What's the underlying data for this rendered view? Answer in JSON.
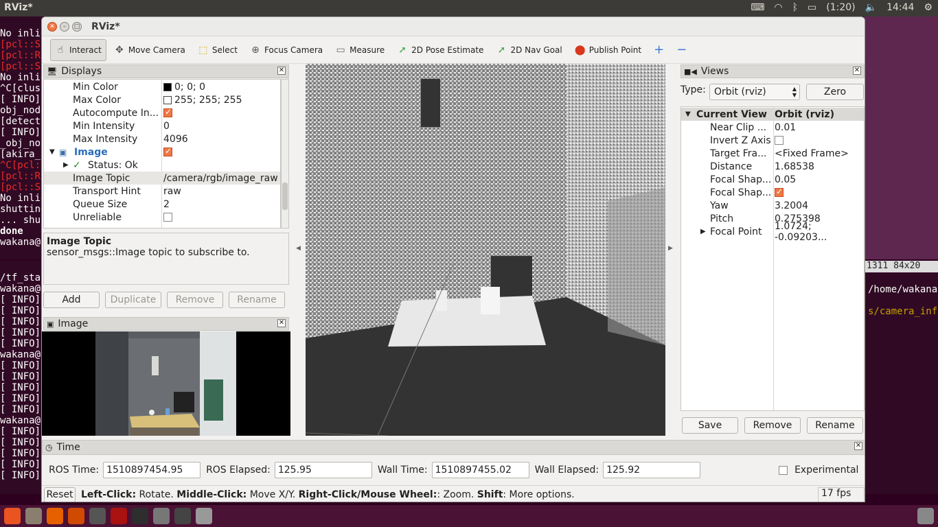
{
  "os": {
    "topbar_title": "RViz*",
    "battery": "(1:20)",
    "clock": "14:44"
  },
  "terminal1_lines": [
    {
      "t": "No inlie",
      "c": ""
    },
    {
      "t": "[pcl::S",
      "c": "red"
    },
    {
      "t": "[pcl::R",
      "c": "red"
    },
    {
      "t": "[pcl::S",
      "c": "red"
    },
    {
      "t": "No inlie",
      "c": ""
    },
    {
      "t": "^C[clust",
      "c": ""
    },
    {
      "t": "[ INFO]",
      "c": ""
    },
    {
      "t": "obj_node",
      "c": ""
    },
    {
      "t": "[detecto",
      "c": ""
    },
    {
      "t": "[ INFO]",
      "c": ""
    },
    {
      "t": "_obj_no",
      "c": ""
    },
    {
      "t": "[akira_",
      "c": ""
    },
    {
      "t": "^C[pcl:",
      "c": "red"
    },
    {
      "t": "[pcl::R",
      "c": "red"
    },
    {
      "t": "[pcl::S",
      "c": "red"
    },
    {
      "t": "No inlie",
      "c": ""
    },
    {
      "t": "shutting",
      "c": ""
    },
    {
      "t": "... shu",
      "c": ""
    },
    {
      "t": "done",
      "c": "bold"
    },
    {
      "t": "wakana@",
      "c": ""
    }
  ],
  "terminal2_lines": [
    "/tf_sta",
    "wakana@",
    "[ INFO]",
    "[ INFO]",
    "[ INFO]",
    "[ INFO]",
    "[ INFO]",
    "wakana@",
    "[ INFO]",
    "[ INFO]",
    "[ INFO]",
    "[ INFO]",
    "[ INFO]",
    "wakana@",
    "[ INFO]",
    "[ INFO]",
    "[ INFO]",
    "[ INFO]",
    "[ INFO]"
  ],
  "terminal3": {
    "size": "1311 84x20",
    "path": "/home/wakana",
    "topic": "s/camera_inf"
  },
  "window": {
    "title": "RViz*"
  },
  "toolbar": [
    {
      "label": "Interact",
      "icon": "hand-icon",
      "color": "#444",
      "active": true
    },
    {
      "label": "Move Camera",
      "icon": "move-camera-icon",
      "color": "#555",
      "active": false
    },
    {
      "label": "Select",
      "icon": "select-icon",
      "color": "#c9a400",
      "active": false
    },
    {
      "label": "Focus Camera",
      "icon": "focus-camera-icon",
      "color": "#555",
      "active": false
    },
    {
      "label": "Measure",
      "icon": "ruler-icon",
      "color": "#666",
      "active": false
    },
    {
      "label": "2D Pose Estimate",
      "icon": "pose-arrow-icon",
      "color": "#3fa53f",
      "active": false
    },
    {
      "label": "2D Nav Goal",
      "icon": "nav-goal-arrow-icon",
      "color": "#3fa53f",
      "active": false
    },
    {
      "label": "Publish Point",
      "icon": "map-pin-icon",
      "color": "#d9381e",
      "active": false
    }
  ],
  "toolbar_extra": {
    "plus": "+",
    "minus": "−"
  },
  "displays": {
    "title": "Displays",
    "rows": [
      {
        "key": "Min Color",
        "val": "0; 0; 0",
        "type": "color",
        "swatch": "#000000",
        "indent": 42
      },
      {
        "key": "Max Color",
        "val": "255; 255; 255",
        "type": "color",
        "swatch": "#ffffff",
        "indent": 42
      },
      {
        "key": "Autocompute In...",
        "val": "",
        "type": "check",
        "on": true,
        "indent": 42
      },
      {
        "key": "Min Intensity",
        "val": "0",
        "type": "text",
        "indent": 42
      },
      {
        "key": "Max Intensity",
        "val": "4096",
        "type": "text",
        "indent": 42
      },
      {
        "key": "Image",
        "val": "",
        "type": "check",
        "on": true,
        "indent": 44,
        "isImage": true
      },
      {
        "key": "Status: Ok",
        "val": "",
        "type": "status",
        "indent": 64
      },
      {
        "key": "Image Topic",
        "val": "/camera/rgb/image_raw",
        "type": "text",
        "indent": 42,
        "sel": true
      },
      {
        "key": "Transport Hint",
        "val": "raw",
        "type": "text",
        "indent": 42
      },
      {
        "key": "Queue Size",
        "val": "2",
        "type": "text",
        "indent": 42
      },
      {
        "key": "Unreliable",
        "val": "",
        "type": "check",
        "on": false,
        "indent": 42
      }
    ],
    "desc_title": "Image Topic",
    "desc_text": "sensor_msgs::Image topic to subscribe to.",
    "buttons": [
      "Add",
      "Duplicate",
      "Remove",
      "Rename"
    ]
  },
  "image_panel": {
    "title": "Image"
  },
  "views": {
    "title": "Views",
    "type_label": "Type:",
    "type_value": "Orbit (rviz)",
    "zero": "Zero",
    "header_key": "Current View",
    "header_val": "Orbit (rviz)",
    "rows": [
      {
        "key": "Near Clip ...",
        "val": "0.01",
        "type": "text"
      },
      {
        "key": "Invert Z Axis",
        "val": "",
        "type": "check",
        "on": false
      },
      {
        "key": "Target Fra...",
        "val": "<Fixed Frame>",
        "type": "text"
      },
      {
        "key": "Distance",
        "val": "1.68538",
        "type": "text"
      },
      {
        "key": "Focal Shap...",
        "val": "0.05",
        "type": "text"
      },
      {
        "key": "Focal Shap...",
        "val": "",
        "type": "check",
        "on": true
      },
      {
        "key": "Yaw",
        "val": "3.2004",
        "type": "text"
      },
      {
        "key": "Pitch",
        "val": "0.275398",
        "type": "text"
      },
      {
        "key": "Focal Point",
        "val": "1.0724; -0.09203...",
        "type": "text",
        "expand": true
      }
    ],
    "buttons": [
      "Save",
      "Remove",
      "Rename"
    ]
  },
  "time": {
    "title": "Time",
    "ros_time_label": "ROS Time:",
    "ros_time": "1510897454.95",
    "ros_elapsed_label": "ROS Elapsed:",
    "ros_elapsed": "125.95",
    "wall_time_label": "Wall Time:",
    "wall_time": "1510897455.02",
    "wall_elapsed_label": "Wall Elapsed:",
    "wall_elapsed": "125.92",
    "experimental": "Experimental"
  },
  "status": {
    "reset": "Reset",
    "h1": "Left-Click:",
    "t1": " Rotate. ",
    "h2": "Middle-Click:",
    "t2": " Move X/Y. ",
    "h3": "Right-Click/Mouse Wheel:",
    "t3": ": Zoom. ",
    "h4": "Shift",
    "t4": ": More options.",
    "fps": "17 fps"
  },
  "launcher": [
    {
      "name": "dash-icon",
      "color": "#e95420"
    },
    {
      "name": "files-icon",
      "color": "#8a7f6f"
    },
    {
      "name": "firefox-icon",
      "color": "#e66000"
    },
    {
      "name": "settings-icon",
      "color": "#d04a02"
    },
    {
      "name": "app-icon",
      "color": "#555"
    },
    {
      "name": "screenshot-icon",
      "color": "#a11"
    },
    {
      "name": "terminal-icon",
      "color": "#2e2e2e"
    },
    {
      "name": "rviz-icon",
      "color": "#777"
    },
    {
      "name": "window-icon",
      "color": "#444"
    },
    {
      "name": "drive-icon",
      "color": "#999"
    }
  ]
}
